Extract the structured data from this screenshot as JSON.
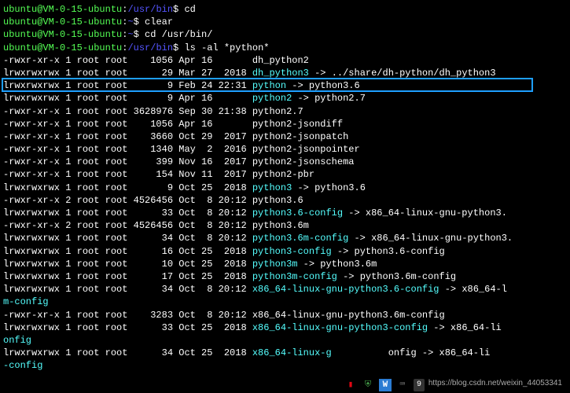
{
  "prompts": [
    {
      "user": "ubuntu@VM-0-15-ubuntu",
      "path": "/usr/bin",
      "cmd": "cd"
    },
    {
      "user": "ubuntu@VM-0-15-ubuntu",
      "path": "~",
      "cmd": "clear"
    },
    {
      "user": "ubuntu@VM-0-15-ubuntu",
      "path": "~",
      "cmd": "cd /usr/bin/"
    },
    {
      "user": "ubuntu@VM-0-15-ubuntu",
      "path": "/usr/bin",
      "cmd": "ls -al *python*"
    }
  ],
  "listing": [
    {
      "perm": "-rwxr-xr-x",
      "n": "1",
      "own": "root",
      "grp": "root",
      "size": "1056",
      "mon": "Apr",
      "day": "16",
      "time": "",
      "name": "dh_python2",
      "link": "",
      "reg": true
    },
    {
      "perm": "lrwxrwxrwx",
      "n": "1",
      "own": "root",
      "grp": "root",
      "size": "29",
      "mon": "Mar",
      "day": "27",
      "time": "2018",
      "name": "dh_python3",
      "link": "../share/dh-python/dh_python3",
      "reg": false
    },
    {
      "perm": "lrwxrwxrwx",
      "n": "1",
      "own": "root",
      "grp": "root",
      "size": "9",
      "mon": "Feb",
      "day": "24",
      "time": "22:31",
      "name": "python",
      "link": "python3.6",
      "reg": false
    },
    {
      "perm": "lrwxrwxrwx",
      "n": "1",
      "own": "root",
      "grp": "root",
      "size": "9",
      "mon": "Apr",
      "day": "16",
      "time": "",
      "name": "python2",
      "link": "python2.7",
      "reg": false
    },
    {
      "perm": "-rwxr-xr-x",
      "n": "1",
      "own": "root",
      "grp": "root",
      "size": "3628976",
      "mon": "Sep",
      "day": "30",
      "time": "21:38",
      "name": "python2.7",
      "link": "",
      "reg": true
    },
    {
      "perm": "-rwxr-xr-x",
      "n": "1",
      "own": "root",
      "grp": "root",
      "size": "1056",
      "mon": "Apr",
      "day": "16",
      "time": "",
      "name": "python2-jsondiff",
      "link": "",
      "reg": true
    },
    {
      "perm": "-rwxr-xr-x",
      "n": "1",
      "own": "root",
      "grp": "root",
      "size": "3660",
      "mon": "Oct",
      "day": "29",
      "time": "2017",
      "name": "python2-jsonpatch",
      "link": "",
      "reg": true
    },
    {
      "perm": "-rwxr-xr-x",
      "n": "1",
      "own": "root",
      "grp": "root",
      "size": "1340",
      "mon": "May",
      "day": "2",
      "time": "2016",
      "name": "python2-jsonpointer",
      "link": "",
      "reg": true
    },
    {
      "perm": "-rwxr-xr-x",
      "n": "1",
      "own": "root",
      "grp": "root",
      "size": "399",
      "mon": "Nov",
      "day": "16",
      "time": "2017",
      "name": "python2-jsonschema",
      "link": "",
      "reg": true
    },
    {
      "perm": "-rwxr-xr-x",
      "n": "1",
      "own": "root",
      "grp": "root",
      "size": "154",
      "mon": "Nov",
      "day": "11",
      "time": "2017",
      "name": "python2-pbr",
      "link": "",
      "reg": true
    },
    {
      "perm": "lrwxrwxrwx",
      "n": "1",
      "own": "root",
      "grp": "root",
      "size": "9",
      "mon": "Oct",
      "day": "25",
      "time": "2018",
      "name": "python3",
      "link": "python3.6",
      "reg": false
    },
    {
      "perm": "-rwxr-xr-x",
      "n": "2",
      "own": "root",
      "grp": "root",
      "size": "4526456",
      "mon": "Oct",
      "day": "8",
      "time": "20:12",
      "name": "python3.6",
      "link": "",
      "reg": true
    },
    {
      "perm": "lrwxrwxrwx",
      "n": "1",
      "own": "root",
      "grp": "root",
      "size": "33",
      "mon": "Oct",
      "day": "8",
      "time": "20:12",
      "name": "python3.6-config",
      "link": "x86_64-linux-gnu-python3.",
      "reg": false
    },
    {
      "perm": "-rwxr-xr-x",
      "n": "2",
      "own": "root",
      "grp": "root",
      "size": "4526456",
      "mon": "Oct",
      "day": "8",
      "time": "20:12",
      "name": "python3.6m",
      "link": "",
      "reg": true
    },
    {
      "perm": "lrwxrwxrwx",
      "n": "1",
      "own": "root",
      "grp": "root",
      "size": "34",
      "mon": "Oct",
      "day": "8",
      "time": "20:12",
      "name": "python3.6m-config",
      "link": "x86_64-linux-gnu-python3.",
      "reg": false
    },
    {
      "perm": "lrwxrwxrwx",
      "n": "1",
      "own": "root",
      "grp": "root",
      "size": "16",
      "mon": "Oct",
      "day": "25",
      "time": "2018",
      "name": "python3-config",
      "link": "python3.6-config",
      "reg": false
    },
    {
      "perm": "lrwxrwxrwx",
      "n": "1",
      "own": "root",
      "grp": "root",
      "size": "10",
      "mon": "Oct",
      "day": "25",
      "time": "2018",
      "name": "python3m",
      "link": "python3.6m",
      "reg": false
    },
    {
      "perm": "lrwxrwxrwx",
      "n": "1",
      "own": "root",
      "grp": "root",
      "size": "17",
      "mon": "Oct",
      "day": "25",
      "time": "2018",
      "name": "python3m-config",
      "link": "python3.6m-config",
      "reg": false
    },
    {
      "perm": "lrwxrwxrwx",
      "n": "1",
      "own": "root",
      "grp": "root",
      "size": "34",
      "mon": "Oct",
      "day": "8",
      "time": "20:12",
      "name": "x86_64-linux-gnu-python3.6-config",
      "link": "x86_64-l",
      "reg": false
    }
  ],
  "wrap1": "m-config",
  "extra": [
    {
      "perm": "-rwxr-xr-x",
      "n": "1",
      "own": "root",
      "grp": "root",
      "size": "3283",
      "mon": "Oct",
      "day": "8",
      "time": "20:12",
      "name": "x86_64-linux-gnu-python3.6m-config",
      "link": "",
      "reg": true
    },
    {
      "perm": "lrwxrwxrwx",
      "n": "1",
      "own": "root",
      "grp": "root",
      "size": "33",
      "mon": "Oct",
      "day": "25",
      "time": "2018",
      "name": "x86_64-linux-gnu-python3-config",
      "link": "x86_64-li",
      "reg": false
    }
  ],
  "wrap2": "onfig",
  "extra2": [
    {
      "perm": "lrwxrwxrwx",
      "n": "1",
      "own": "root",
      "grp": "root",
      "size": "34",
      "mon": "Oct",
      "day": "25",
      "time": "2018",
      "name": "x86_64-linux-g",
      "fragment": "onfig -> x86_64-li",
      "reg": false
    }
  ],
  "wrap3": "-config",
  "watermark": "https://blog.csdn.net/weixin_44053341",
  "tray_badge": "9"
}
